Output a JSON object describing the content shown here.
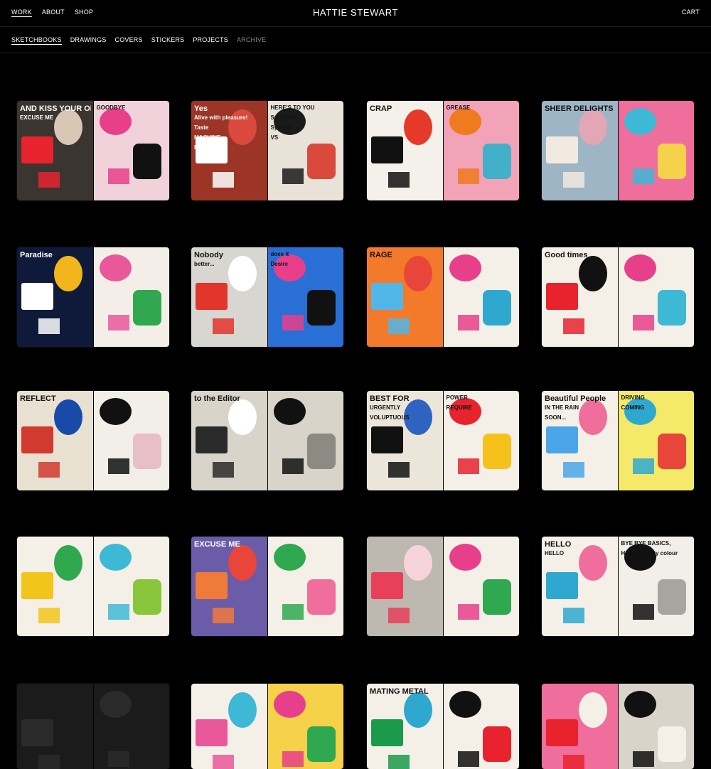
{
  "header": {
    "nav": [
      "WORK",
      "ABOUT",
      "SHOP"
    ],
    "title": "HATTIE STEWART",
    "cart": "CART"
  },
  "subnav": [
    "SKETCHBOOKS",
    "DRAWINGS",
    "COVERS",
    "STICKERS",
    "PROJECTS",
    "ARCHIVE"
  ],
  "gallery": {
    "items": [
      {
        "name": "sketchbook-1",
        "left": {
          "bg": "#3a3530",
          "accent": "#e8232e",
          "color2": "#d9c7b5"
        },
        "right": {
          "bg": "#f1d2da",
          "accent": "#e83f8a",
          "color2": "#111111"
        },
        "texts": [
          "AND KISS YOUR OLD",
          "GOODBYE",
          "EXCUSE ME"
        ]
      },
      {
        "name": "sketchbook-2",
        "left": {
          "bg": "#9c3526",
          "accent": "#ffffff",
          "color2": "#d94a3c"
        },
        "right": {
          "bg": "#e9e2d8",
          "accent": "#1a1a1a",
          "color2": "#d94a3c"
        },
        "texts": [
          "Yes",
          "HERE'S TO YOU",
          "Alive with pleasure!",
          "SO LIGHT",
          "Taste",
          "Symbol",
          "MACHINE",
          "VS",
          "MAN"
        ]
      },
      {
        "name": "sketchbook-3",
        "left": {
          "bg": "#f4f1ea",
          "accent": "#111111",
          "color2": "#e53a2a"
        },
        "right": {
          "bg": "#f3a3b8",
          "accent": "#f07a1e",
          "color2": "#43b0c9"
        },
        "texts": [
          "CRAP",
          "GREASE"
        ]
      },
      {
        "name": "sketchbook-4",
        "left": {
          "bg": "#9db5c4",
          "accent": "#f2e9e0",
          "color2": "#e2a6b4"
        },
        "right": {
          "bg": "#f06e9c",
          "accent": "#3db8d5",
          "color2": "#f5d24a"
        },
        "texts": [
          "SHEER DELIGHTS"
        ]
      },
      {
        "name": "sketchbook-5",
        "left": {
          "bg": "#0f1a3a",
          "accent": "#ffffff",
          "color2": "#f2b51c"
        },
        "right": {
          "bg": "#f3efe8",
          "accent": "#e8589a",
          "color2": "#2fa84f"
        },
        "texts": [
          "Paradise"
        ]
      },
      {
        "name": "sketchbook-6",
        "left": {
          "bg": "#d8d6d0",
          "accent": "#e2352b",
          "color2": "#ffffff"
        },
        "right": {
          "bg": "#2a6fd6",
          "accent": "#e83f8a",
          "color2": "#111111"
        },
        "texts": [
          "Nobody",
          "does it",
          "better...",
          "Desire"
        ]
      },
      {
        "name": "sketchbook-7",
        "left": {
          "bg": "#f27a2a",
          "accent": "#51b6e8",
          "color2": "#e8463a"
        },
        "right": {
          "bg": "#f4f0e8",
          "accent": "#e83f8a",
          "color2": "#2fa8d0"
        },
        "texts": [
          "RAGE"
        ]
      },
      {
        "name": "sketchbook-8",
        "left": {
          "bg": "#f4f0e8",
          "accent": "#e8232e",
          "color2": "#111111"
        },
        "right": {
          "bg": "#f4f0e8",
          "accent": "#e83f8a",
          "color2": "#3db8d5"
        },
        "texts": [
          "Good times"
        ]
      },
      {
        "name": "sketchbook-9",
        "left": {
          "bg": "#e8e0d0",
          "accent": "#d13a2e",
          "color2": "#1a4aa8"
        },
        "right": {
          "bg": "#f2efe8",
          "accent": "#111111",
          "color2": "#e8bfc6"
        },
        "texts": [
          "REFLECT"
        ]
      },
      {
        "name": "sketchbook-10",
        "left": {
          "bg": "#d9d4c9",
          "accent": "#2a2a2a",
          "color2": "#ffffff"
        },
        "right": {
          "bg": "#d9d4c9",
          "accent": "#111111",
          "color2": "#8d8a84"
        },
        "texts": [
          "to the Editor"
        ]
      },
      {
        "name": "sketchbook-11",
        "left": {
          "bg": "#ece6da",
          "accent": "#111111",
          "color2": "#2f63c2"
        },
        "right": {
          "bg": "#f4f0e8",
          "accent": "#e8232e",
          "color2": "#f5c21c"
        },
        "texts": [
          "BEST FOR",
          "POWER",
          "URGENTLY",
          "REQUIRE",
          "VOLUPTUOUS"
        ]
      },
      {
        "name": "sketchbook-12",
        "left": {
          "bg": "#f4f0e8",
          "accent": "#4aa6e8",
          "color2": "#f06e9c"
        },
        "right": {
          "bg": "#f5e96a",
          "accent": "#2fa8d0",
          "color2": "#e8463a"
        },
        "texts": [
          "Beautiful People",
          "DRIVING",
          "IN THE RAIN",
          "COMING",
          "SOON..."
        ]
      },
      {
        "name": "sketchbook-13",
        "left": {
          "bg": "#f4f0e8",
          "accent": "#f2c51c",
          "color2": "#2fa84f"
        },
        "right": {
          "bg": "#f4f0e8",
          "accent": "#3db8d5",
          "color2": "#8ac63c"
        },
        "texts": []
      },
      {
        "name": "sketchbook-14",
        "left": {
          "bg": "#6a5ca8",
          "accent": "#f07a3a",
          "color2": "#e8463a"
        },
        "right": {
          "bg": "#f4f0e8",
          "accent": "#2fa84f",
          "color2": "#f06e9c"
        },
        "texts": [
          "EXCUSE ME"
        ]
      },
      {
        "name": "sketchbook-15",
        "left": {
          "bg": "#bdb8b0",
          "accent": "#e83f5a",
          "color2": "#f7d4dc"
        },
        "right": {
          "bg": "#f4f0e8",
          "accent": "#e83f8a",
          "color2": "#2fa84f"
        },
        "texts": []
      },
      {
        "name": "sketchbook-16",
        "left": {
          "bg": "#f4f0e8",
          "accent": "#2fa8d0",
          "color2": "#f06e9c"
        },
        "right": {
          "bg": "#f2efe8",
          "accent": "#111111",
          "color2": "#a8a5a0"
        },
        "texts": [
          "HELLO",
          "BYE BYE BASICS,",
          "HELLO",
          "High intensity colour"
        ]
      },
      {
        "name": "sketchbook-17",
        "left": {
          "bg": "#1b1b1b",
          "accent": "#2a2a2a",
          "color2": "#1b1b1b"
        },
        "right": {
          "bg": "#1b1b1b",
          "accent": "#2a2a2a",
          "color2": "#1b1b1b"
        },
        "texts": []
      },
      {
        "name": "sketchbook-18",
        "left": {
          "bg": "#f4f0e8",
          "accent": "#e8589a",
          "color2": "#3db8d5"
        },
        "right": {
          "bg": "#f5d24a",
          "accent": "#e83f8a",
          "color2": "#2fa84f"
        },
        "texts": []
      },
      {
        "name": "sketchbook-19",
        "left": {
          "bg": "#f4f0e8",
          "accent": "#1a9a4a",
          "color2": "#2fa8d0"
        },
        "right": {
          "bg": "#f4f0e8",
          "accent": "#111111",
          "color2": "#e8232e"
        },
        "texts": [
          "MATING METAL"
        ]
      },
      {
        "name": "sketchbook-20",
        "left": {
          "bg": "#f06e9c",
          "accent": "#e8232e",
          "color2": "#f4f0e8"
        },
        "right": {
          "bg": "#d9d4c9",
          "accent": "#111111",
          "color2": "#f4f0e8"
        },
        "texts": []
      }
    ]
  }
}
